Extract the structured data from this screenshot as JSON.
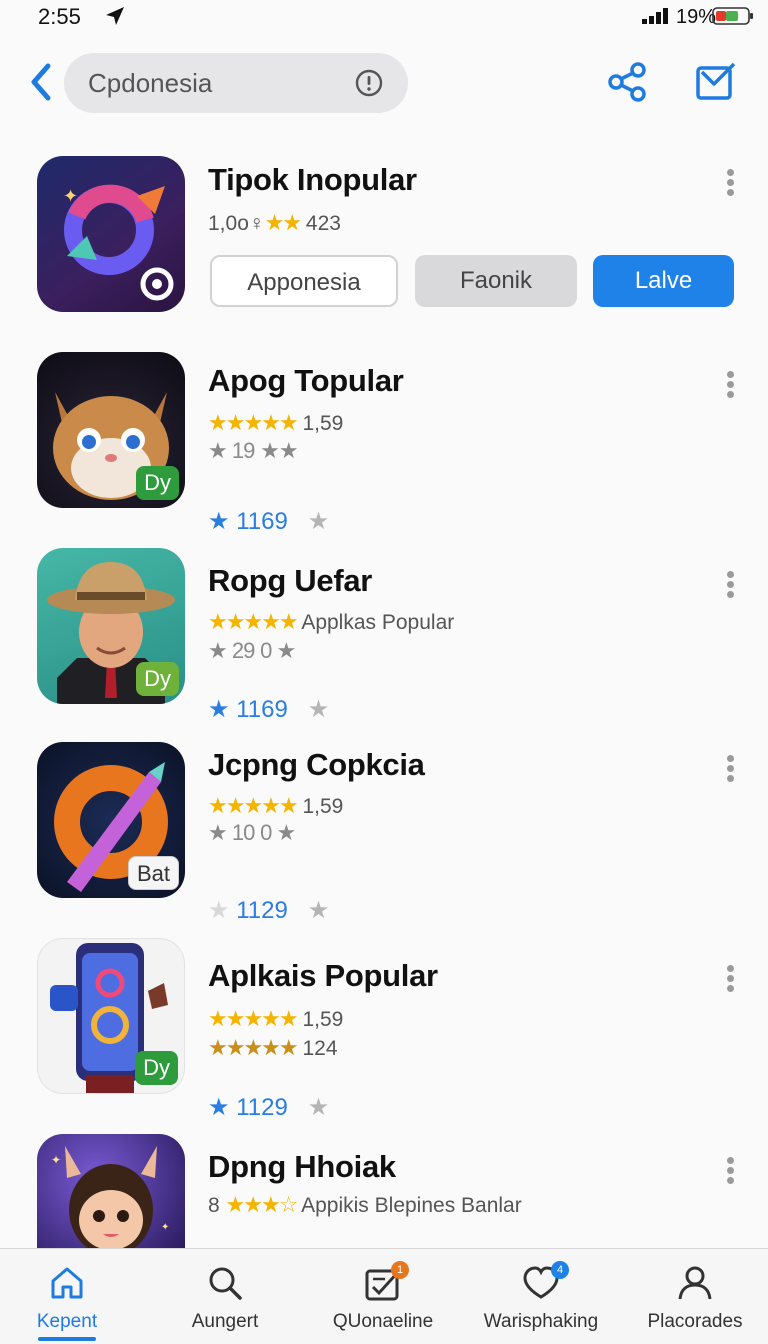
{
  "status_bar": {
    "time": "2:55",
    "battery_percent": "19%"
  },
  "header": {
    "search_text": "Cpdonesia"
  },
  "colors": {
    "accent": "#1e82e8",
    "star": "#f4b400"
  },
  "apps": [
    {
      "title": "Tipok Inopular",
      "stats_prefix": "1,0o",
      "stats_stars": "★★",
      "stats_suffix": "423",
      "buttons": {
        "outline": "Apponesia",
        "gray": "Faonik",
        "primary": "Lalve"
      }
    },
    {
      "title": "Apog Topular",
      "badge": "Dy",
      "line1_stars": "★★★★★",
      "line1_text": "1,59",
      "line2_left": "★ 19",
      "line2_right": "★★",
      "count": "1169"
    },
    {
      "title": "Ropg Uefar",
      "badge": "Dy",
      "line1_stars": "★★★★★",
      "line1_text": "Applkas Popular",
      "line2_left": "★ 29",
      "line2_right": "0 ★",
      "count": "1169"
    },
    {
      "title": "Jcpng Copkcia",
      "badge": "Bat",
      "line1_stars": "★★★★★",
      "line1_text": "1,59",
      "line2_left": "★ 10",
      "line2_right": "0 ★",
      "count": "1129"
    },
    {
      "title": "Aplkais Popular",
      "badge": "Dy",
      "line1_stars": "★★★★★",
      "line1_text": "1,59",
      "line2_stars": "★★★★★",
      "line2_text": "124",
      "count": "1129"
    },
    {
      "title": "Dpng Hhoiak",
      "line1_prefix": "8",
      "line1_stars": "★★★☆",
      "line1_text": "Appikis Blepines Banlar"
    }
  ],
  "tabs": [
    {
      "label": "Kepent",
      "icon": "home-icon",
      "active": true
    },
    {
      "label": "Aungert",
      "icon": "search-icon"
    },
    {
      "label": "QUonaeline",
      "icon": "updates-icon",
      "badge": "1"
    },
    {
      "label": "Warisphaking",
      "icon": "chat-icon",
      "badge": "4"
    },
    {
      "label": "Placorades",
      "icon": "profile-icon"
    }
  ]
}
